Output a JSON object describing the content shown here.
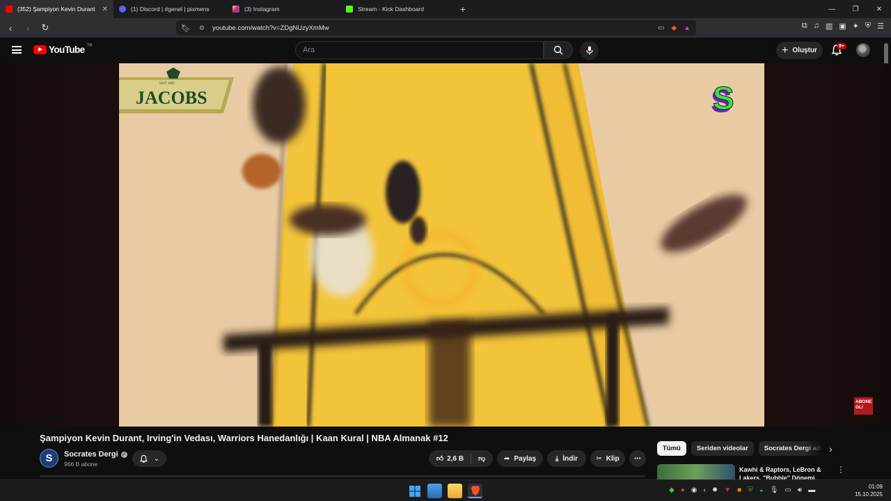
{
  "browser": {
    "tabs": [
      {
        "title": "(352) Şampiyon Kevin Durant",
        "color": "#ff0000",
        "active": true
      },
      {
        "title": "(1) Discord | #genel | pixmens",
        "color": "#5865f2",
        "active": false
      },
      {
        "title": "(3) Instagram",
        "color": "#d62976",
        "active": false
      },
      {
        "title": "Stream - Kick Dashboard",
        "color": "#53fc18",
        "active": false
      }
    ],
    "url": "youtube.com/watch?v=ZDgNUzyXmMw"
  },
  "youtube": {
    "logo_text": "YouTube",
    "country": "TR",
    "search_placeholder": "Ara",
    "create_label": "Oluştur",
    "notification_count": "9+"
  },
  "video": {
    "sponsor": "JACOBS",
    "sponsor_since": "SEIT 1895",
    "channel_watermark": "S",
    "subscribe_overlay": "ABONE OL!",
    "title": "Şampiyon Kevin Durant, Irving'in Vedası, Warriors Hanedanlığı | Kaan Kural | NBA Almanak #12",
    "channel": {
      "name": "Socrates Dergi",
      "avatar_letter": "S",
      "subscribers": "966 B abone"
    },
    "actions": {
      "likes": "2,6 B",
      "share": "Paylaş",
      "download": "İndir",
      "clip": "Klip"
    }
  },
  "sidebar": {
    "chips": [
      "Tümü",
      "Seriden videolar",
      "Socrates Dergi adlı yü"
    ],
    "recommendation": {
      "title": "Kawhi & Raptors, LeBron & Lakers, \"Bubble\" Dönemi, Yaz..."
    }
  },
  "taskbar": {
    "time": "01:09",
    "date": "15.10.2025"
  },
  "colors": {
    "accent": "#ff0000",
    "background": "#0f0f0f",
    "surface": "#272727"
  }
}
